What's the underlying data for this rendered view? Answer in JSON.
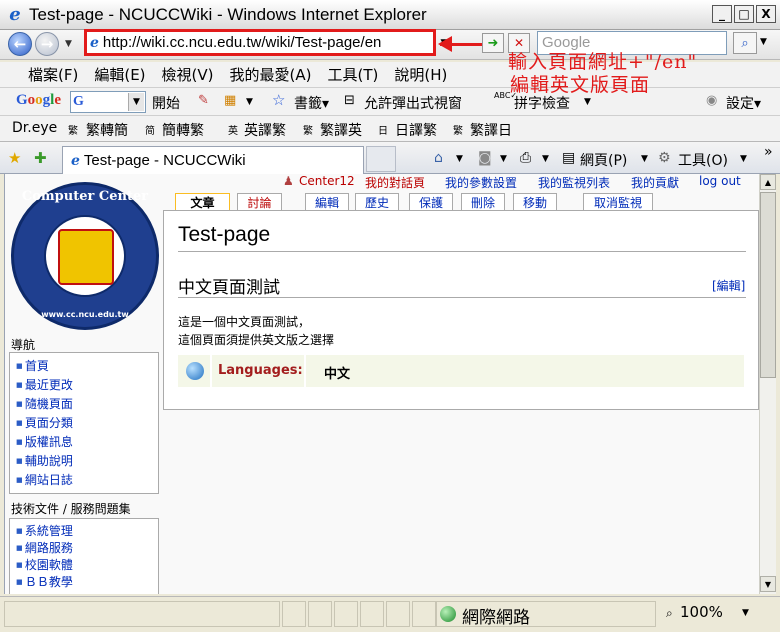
{
  "window": {
    "title": "Test-page - NCUCCWiki - Windows Internet Explorer",
    "min_label": "_",
    "max_label": "□",
    "close_label": "X"
  },
  "address": {
    "url": "http://wiki.cc.ncu.edu.tw/wiki/Test-page/en",
    "search_placeholder": "Google"
  },
  "annotation": {
    "line1": "輸入頁面網址+\"/en\"",
    "line2": "編輯英文版頁面"
  },
  "menu": [
    "檔案(F)",
    "編輯(E)",
    "檢視(V)",
    "我的最愛(A)",
    "工具(T)",
    "說明(H)"
  ],
  "google_toolbar": {
    "logo": "Google",
    "input_char": "G",
    "start": "開始",
    "bookmarks": "書籤▾",
    "popup": "允許彈出式視窗",
    "spell": "拼字檢查",
    "settings": "設定▾"
  },
  "dreye_toolbar": {
    "brand": "Dr.eye",
    "items": [
      "繁轉簡",
      "簡轉繁",
      "英譯繁",
      "繁譯英",
      "日譯繁",
      "繁譯日"
    ]
  },
  "tabbar": {
    "tab_title": "Test-page - NCUCCWiki",
    "page_menu": "網頁(P)",
    "tools_menu": "工具(O)"
  },
  "personal": {
    "user": "Center12",
    "talk": "我的對話頁",
    "prefs": "我的參數設置",
    "watchlist": "我的監視列表",
    "contribs": "我的貢獻",
    "logout": "log out"
  },
  "page_tabs": {
    "article": "文章",
    "discussion": "討論",
    "edit": "編輯",
    "history": "歷史",
    "protect": "保護",
    "delete": "刪除",
    "move": "移動",
    "unwatch": "取消監視"
  },
  "logo": {
    "top_text": "Computer Center",
    "bottom_text": "www.cc.ncu.edu.tw"
  },
  "navigation": {
    "title": "導航",
    "items": [
      "首頁",
      "最近更改",
      "隨機頁面",
      "頁面分類",
      "版權訊息",
      "輔助說明",
      "網站日誌"
    ]
  },
  "tech_docs": {
    "title": "技術文件 / 服務問題集",
    "items": [
      "系統管理",
      "網路服務",
      "校園軟體",
      "ＢＢ教學"
    ]
  },
  "article": {
    "heading": "Test-page",
    "section": "中文頁面測試",
    "edit_link": "[編輯]",
    "line1": "這是一個中文頁面測試，",
    "line2": "這個頁面須提供英文版之選擇",
    "languages_label": "Languages:",
    "languages_value": "中文"
  },
  "status": {
    "zone": "網際網路",
    "zoom": "100%"
  },
  "colors": {
    "annotation_red": "#e21b1b",
    "link_blue": "#002bb8",
    "new_link_red": "#ba0000"
  }
}
